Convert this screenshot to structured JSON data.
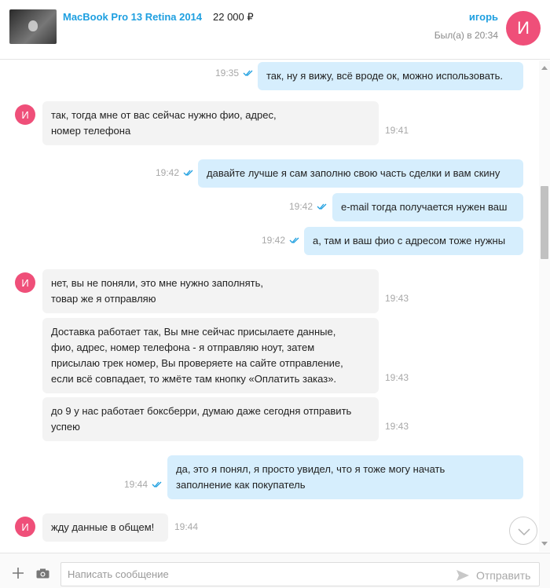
{
  "header": {
    "item_title": "MacBook Pro 13 Retina 2014",
    "item_price": "22 000 ₽",
    "user_name": "игорь",
    "user_status": "Был(а) в 20:34",
    "avatar_letter": "И"
  },
  "messages": [
    {
      "dir": "out",
      "text": "так, ну я вижу, всё вроде ок, можно использовать.",
      "time": "19:35"
    },
    {
      "dir": "in",
      "avatar": "И",
      "text": "так, тогда мне от вас сейчас нужно фио, адрес, номер телефона",
      "time": "19:41"
    },
    {
      "dir": "out",
      "text": "давайте лучше я сам заполню свою часть сделки и вам скину",
      "time": "19:42"
    },
    {
      "dir": "out",
      "text": "e-mail тогда получается нужен ваш",
      "time": "19:42"
    },
    {
      "dir": "out",
      "text": "а, там и ваш фио с адресом тоже нужны",
      "time": "19:42"
    },
    {
      "dir": "in",
      "avatar": "И",
      "text": "нет, вы не поняли, это мне нужно заполнять, товар же я отправляю",
      "time": "19:43"
    },
    {
      "dir": "in",
      "text": "Доставка работает так, Вы мне сейчас присылаете данные, фио, адрес, номер телефона - я отправляю ноут, затем присылаю трек номер, Вы проверяете на сайте отправление, если всё совпадает, то жмёте там кнопку «Оплатить заказ».",
      "time": "19:43"
    },
    {
      "dir": "in",
      "text": "до 9 у нас работает боксберри, думаю даже сегодня отправить успею",
      "time": "19:43"
    },
    {
      "dir": "out",
      "text": "да, это я понял, я просто увидел, что я тоже могу начать заполнение как покупатель",
      "time": "19:44"
    },
    {
      "dir": "in",
      "avatar": "И",
      "text": "жду данные в общем!",
      "time": "19:44"
    }
  ],
  "composer": {
    "placeholder": "Написать сообщение",
    "send_label": "Отправить"
  },
  "colors": {
    "accent": "#1e9fe0",
    "avatar": "#ef4f79",
    "bubble_out": "#d6eefd",
    "bubble_in": "#f3f3f3"
  }
}
